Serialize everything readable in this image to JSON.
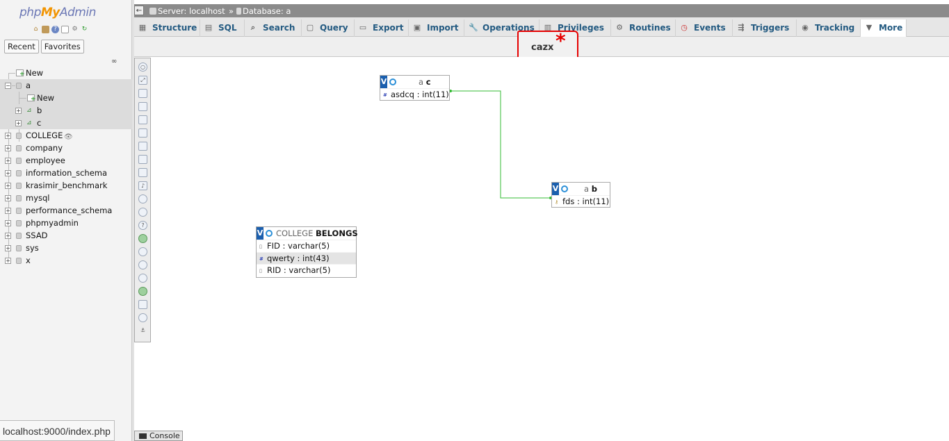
{
  "nav": {
    "logo_php": "php",
    "logo_my": "My",
    "logo_admin": "Admin",
    "recent_label": "Recent",
    "favorites_label": "Favorites",
    "tree": [
      {
        "label": "New",
        "type": "new"
      },
      {
        "label": "a",
        "type": "db",
        "expanded": true
      },
      {
        "label": "New",
        "type": "new-child"
      },
      {
        "label": "b",
        "type": "table"
      },
      {
        "label": "c",
        "type": "table"
      },
      {
        "label": "COLLEGE",
        "type": "db"
      },
      {
        "label": "company",
        "type": "db"
      },
      {
        "label": "employee",
        "type": "db"
      },
      {
        "label": "information_schema",
        "type": "db"
      },
      {
        "label": "krasimir_benchmark",
        "type": "db"
      },
      {
        "label": "mysql",
        "type": "db"
      },
      {
        "label": "performance_schema",
        "type": "db"
      },
      {
        "label": "phpmyadmin",
        "type": "db"
      },
      {
        "label": "SSAD",
        "type": "db"
      },
      {
        "label": "sys",
        "type": "db"
      },
      {
        "label": "x",
        "type": "db"
      }
    ]
  },
  "breadcrumb": {
    "server": "Server: localhost",
    "sep": "»",
    "database": "Database: a"
  },
  "tabs": [
    {
      "label": "Structure",
      "icon": "structure-icon"
    },
    {
      "label": "SQL",
      "icon": "sql-icon"
    },
    {
      "label": "Search",
      "icon": "search-icon"
    },
    {
      "label": "Query",
      "icon": "query-icon"
    },
    {
      "label": "Export",
      "icon": "export-icon"
    },
    {
      "label": "Import",
      "icon": "import-icon"
    },
    {
      "label": "Operations",
      "icon": "wrench-icon"
    },
    {
      "label": "Privileges",
      "icon": "privileges-icon"
    },
    {
      "label": "Routines",
      "icon": "routines-icon"
    },
    {
      "label": "Events",
      "icon": "clock-icon"
    },
    {
      "label": "Triggers",
      "icon": "triggers-icon"
    },
    {
      "label": "Tracking",
      "icon": "eye-icon"
    },
    {
      "label": "More",
      "icon": "triangle-down-icon"
    }
  ],
  "annotation": {
    "text": "cazx",
    "mark": "*"
  },
  "designer": {
    "tables": [
      {
        "db": "a",
        "name": "c",
        "columns": [
          {
            "text": "asdcq : int(11)",
            "kind": "num"
          }
        ]
      },
      {
        "db": "a",
        "name": "b",
        "columns": [
          {
            "text": "fds : int(11)",
            "kind": "key"
          }
        ]
      },
      {
        "db": "COLLEGE",
        "name": "BELONGS",
        "columns": [
          {
            "text": "FID : varchar(5)",
            "kind": "str"
          },
          {
            "text": "qwerty : int(43)",
            "kind": "num"
          },
          {
            "text": "RID : varchar(5)",
            "kind": "str"
          }
        ]
      }
    ],
    "toggle_label": "V"
  },
  "console_label": "Console",
  "status_url": "localhost:9000/index.php",
  "colors": {
    "relation_line": "#33bb33",
    "annotation": "#e60000",
    "tab_text": "#235a81",
    "topbar": "#8b8b8b"
  }
}
